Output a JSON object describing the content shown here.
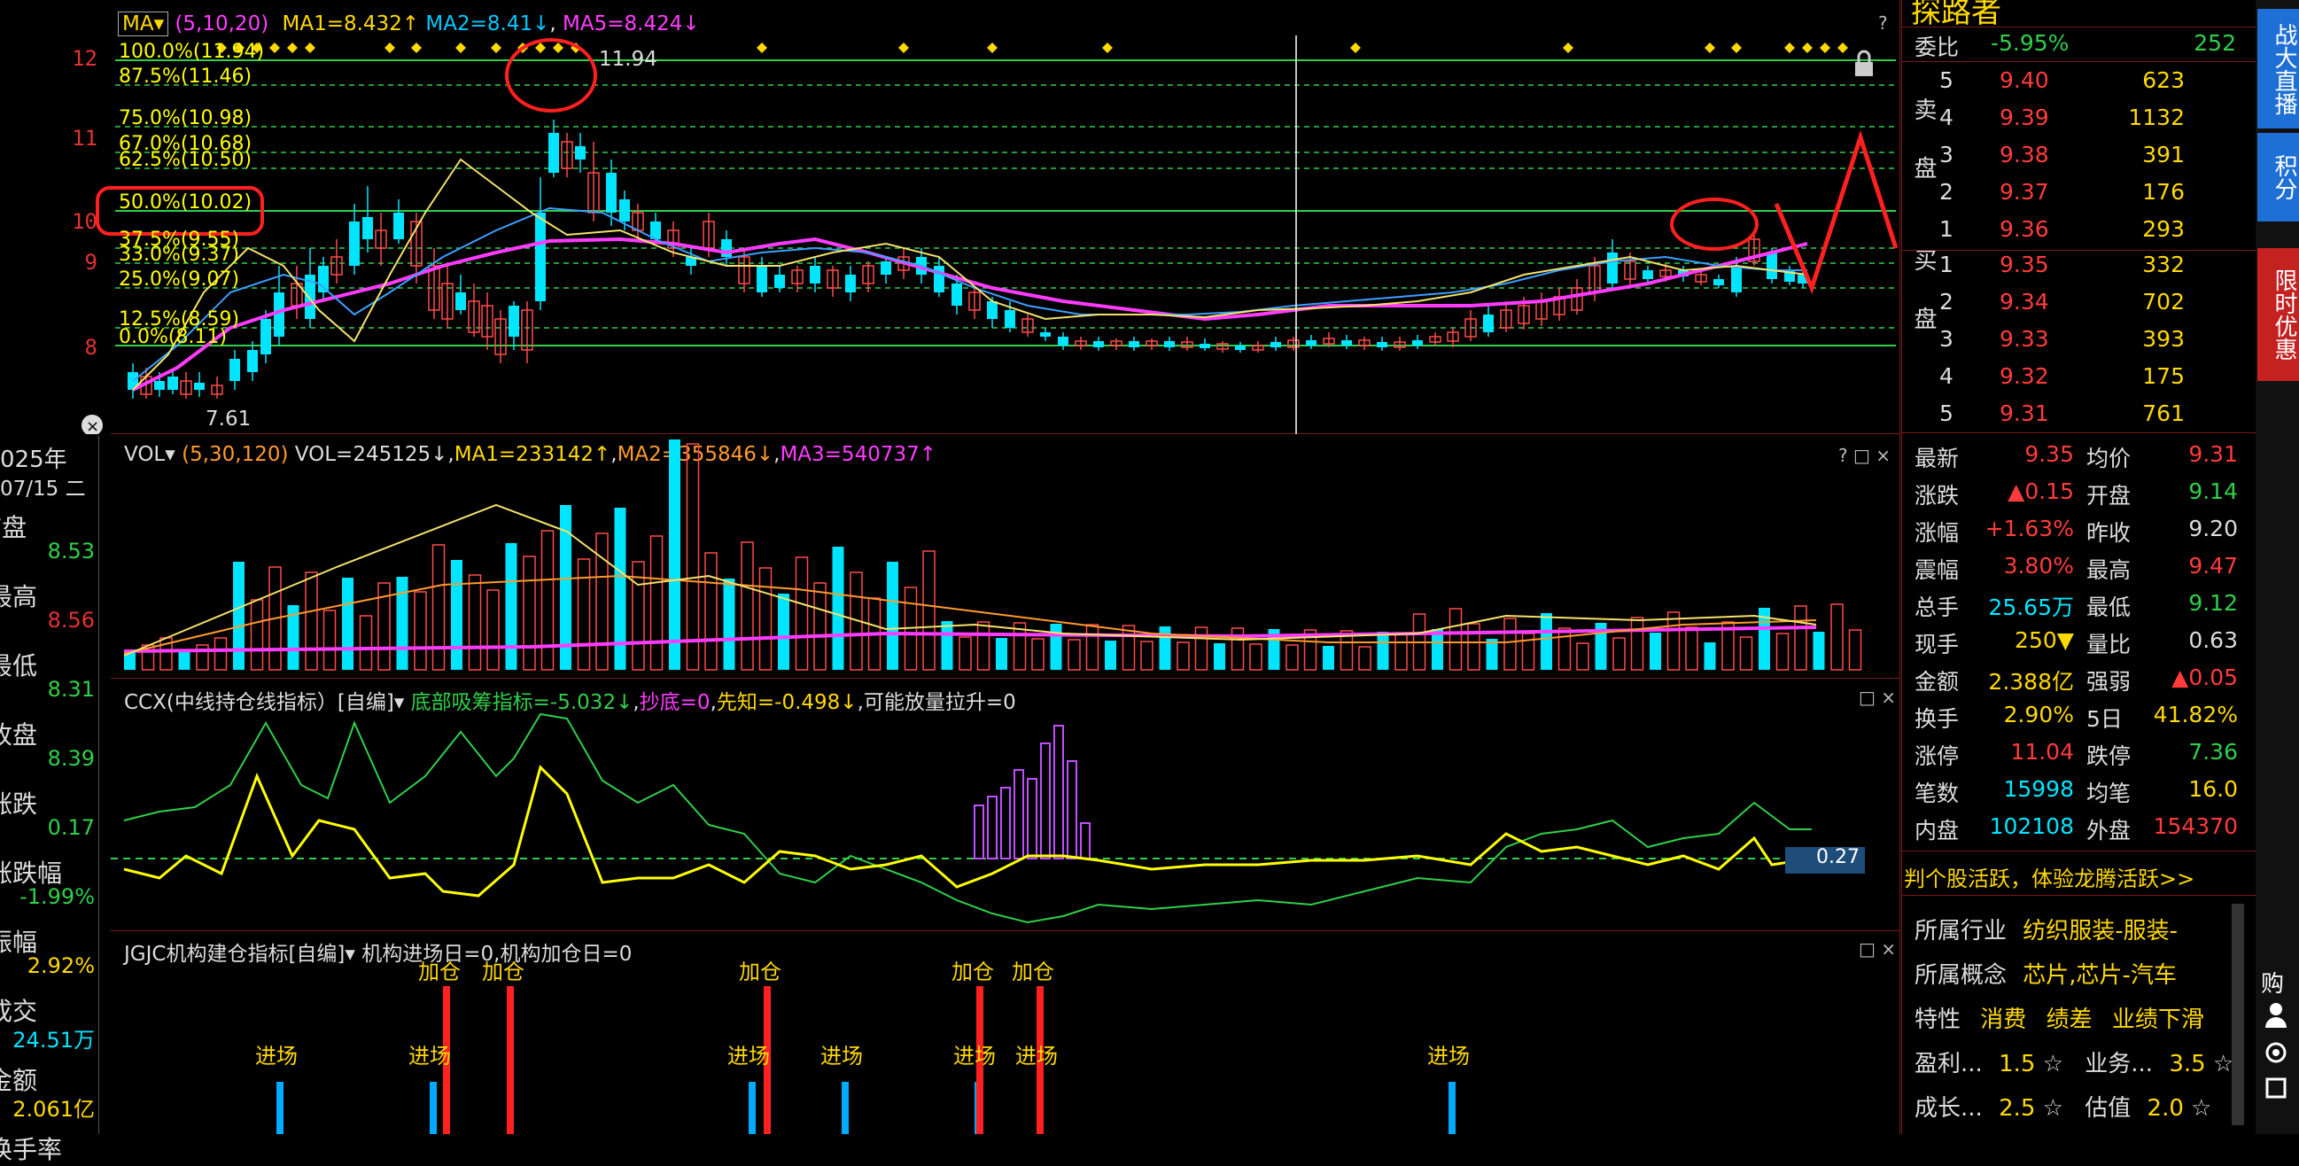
{
  "main_chart": {
    "ma_label": "MA",
    "params": "(5,10,20)",
    "ma1": "MA1=8.432↑",
    "ma2": "MA2=8.41↓",
    "ma5": "MA5=8.424↓",
    "y_ticks": [
      "12",
      "11",
      "10",
      "9",
      "8"
    ],
    "fib_levels": [
      "100.0%(11.94)",
      "87.5%(11.46)",
      "75.0%(10.98)",
      "67.0%(10.68)",
      "62.5%(10.50)",
      "50.0%(10.02)",
      "37.5%(9.55)",
      "33.0%(9.37)",
      "25.0%(9.07)",
      "12.5%(8.59)",
      "0.0%(8.11)"
    ],
    "high_label": "11.94",
    "low_label": "7.61",
    "help": "?"
  },
  "vol_chart": {
    "label": "VOL",
    "params": "(5,30,120)",
    "vol": "VOL=245125↓",
    "ma1": "MA1=233142↑",
    "ma2": "MA2=355846↓",
    "ma3": "MA3=540737↑",
    "controls": "? □ ×"
  },
  "ccx_chart": {
    "title": "CCX(中线持仓线指标）[自编]",
    "ind1": "底部吸筹指标=-5.032↓",
    "ind2": "抄底=0",
    "ind3": "先知=-0.498↓",
    "ind4": "可能放量拉升=0",
    "value_box": "0.27",
    "controls": "□ ×"
  },
  "jgjc_chart": {
    "title": "JGJC机构建仓指标[自编]",
    "ind1": "机构进场日=0",
    "ind2": "机构加仓日=0",
    "controls": "□ ×",
    "jc_label": "进场",
    "jia_label": "加仓"
  },
  "left_panel": {
    "year": "025年",
    "date": "07/15 二",
    "rows": [
      {
        "label": "F盘",
        "value": "8.53"
      },
      {
        "label": "最高",
        "value": "8.56"
      },
      {
        "label": "最低",
        "value": "8.31"
      },
      {
        "label": "收盘",
        "value": "8.39"
      },
      {
        "label": "涨跌",
        "value": "0.17"
      },
      {
        "label": "涨跌幅",
        "value": "-1.99%"
      },
      {
        "label": "振幅",
        "value": "2.92%"
      },
      {
        "label": "成交",
        "value": "24.51万"
      },
      {
        "label": "金额",
        "value": "2.061亿"
      },
      {
        "label": "换手率",
        "value": ""
      }
    ]
  },
  "right_panel": {
    "stock_name": "探路者",
    "weibi_label": "委比",
    "weibi_value": "-5.95%",
    "weibi_count": "252",
    "sell_label": "卖盘",
    "buy_label": "买盘",
    "sell": [
      {
        "n": "5",
        "p": "9.40",
        "v": "623"
      },
      {
        "n": "4",
        "p": "9.39",
        "v": "1132"
      },
      {
        "n": "3",
        "p": "9.38",
        "v": "391"
      },
      {
        "n": "2",
        "p": "9.37",
        "v": "176"
      },
      {
        "n": "1",
        "p": "9.36",
        "v": "293"
      }
    ],
    "buy": [
      {
        "n": "1",
        "p": "9.35",
        "v": "332"
      },
      {
        "n": "2",
        "p": "9.34",
        "v": "702"
      },
      {
        "n": "3",
        "p": "9.33",
        "v": "393"
      },
      {
        "n": "4",
        "p": "9.32",
        "v": "175"
      },
      {
        "n": "5",
        "p": "9.31",
        "v": "761"
      }
    ],
    "stats": [
      {
        "l1": "最新",
        "v1": "9.35",
        "l2": "均价",
        "v2": "9.31"
      },
      {
        "l1": "涨跌",
        "v1": "▲0.15",
        "l2": "开盘",
        "v2": "9.14"
      },
      {
        "l1": "涨幅",
        "v1": "+1.63%",
        "l2": "昨收",
        "v2": "9.20"
      },
      {
        "l1": "震幅",
        "v1": "3.80%",
        "l2": "最高",
        "v2": "9.47"
      },
      {
        "l1": "总手",
        "v1": "25.65万",
        "l2": "最低",
        "v2": "9.12"
      },
      {
        "l1": "现手",
        "v1": "250▼",
        "l2": "量比",
        "v2": "0.63"
      },
      {
        "l1": "金额",
        "v1": "2.388亿",
        "l2": "强弱",
        "v2": "▲0.05"
      },
      {
        "l1": "换手",
        "v1": "2.90%",
        "l2": "5日",
        "v2": "41.82%"
      },
      {
        "l1": "涨停",
        "v1": "11.04",
        "l2": "跌停",
        "v2": "7.36"
      },
      {
        "l1": "笔数",
        "v1": "15998",
        "l2": "均笔",
        "v2": "16.0"
      },
      {
        "l1": "内盘",
        "v1": "102108",
        "l2": "外盘",
        "v2": "154370"
      }
    ],
    "promo": "判个股活跃，体验龙腾活跃>>",
    "industry_label": "所属行业",
    "industry_value": "纺织服装-服装-",
    "concept_label": "所属概念",
    "concept_value": "芯片,芯片-汽车",
    "trait_label": "特性",
    "traits": [
      "消费",
      "绩差",
      "业绩下滑"
    ],
    "rating1_label": "盈利...",
    "rating1_value": "1.5",
    "rating2_label": "业务...",
    "rating2_value": "3.5",
    "rating3_label": "成长...",
    "rating3_value": "2.5",
    "rating4_label": "估值",
    "rating4_value": "2.0"
  },
  "side_buttons": {
    "b1": "战大直播",
    "b2": "积分",
    "b3": "限时优惠",
    "b4": "购"
  }
}
